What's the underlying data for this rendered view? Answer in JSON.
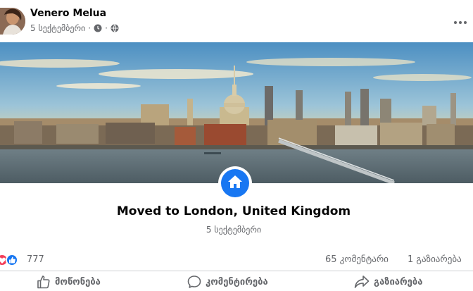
{
  "post": {
    "author": "Venero Melua",
    "date": "5 სექტემბერი",
    "privacy_icon": "globe-icon",
    "more_icon": "ellipsis-icon"
  },
  "life_event": {
    "icon": "home-icon",
    "title": "Moved to London, United Kingdom",
    "date": "5 სექტემბერი"
  },
  "stats": {
    "reactions_count": "777",
    "reaction_icons": [
      "love-icon",
      "like-icon"
    ],
    "comments": "65 კომენტარი",
    "shares": "1 გაზიარება"
  },
  "actions": {
    "like": "მოწონება",
    "comment": "კომენტირება",
    "share": "გაზიარება"
  },
  "colors": {
    "accent": "#1877f2",
    "love": "#f33e58",
    "secondary_text": "#65676b"
  }
}
